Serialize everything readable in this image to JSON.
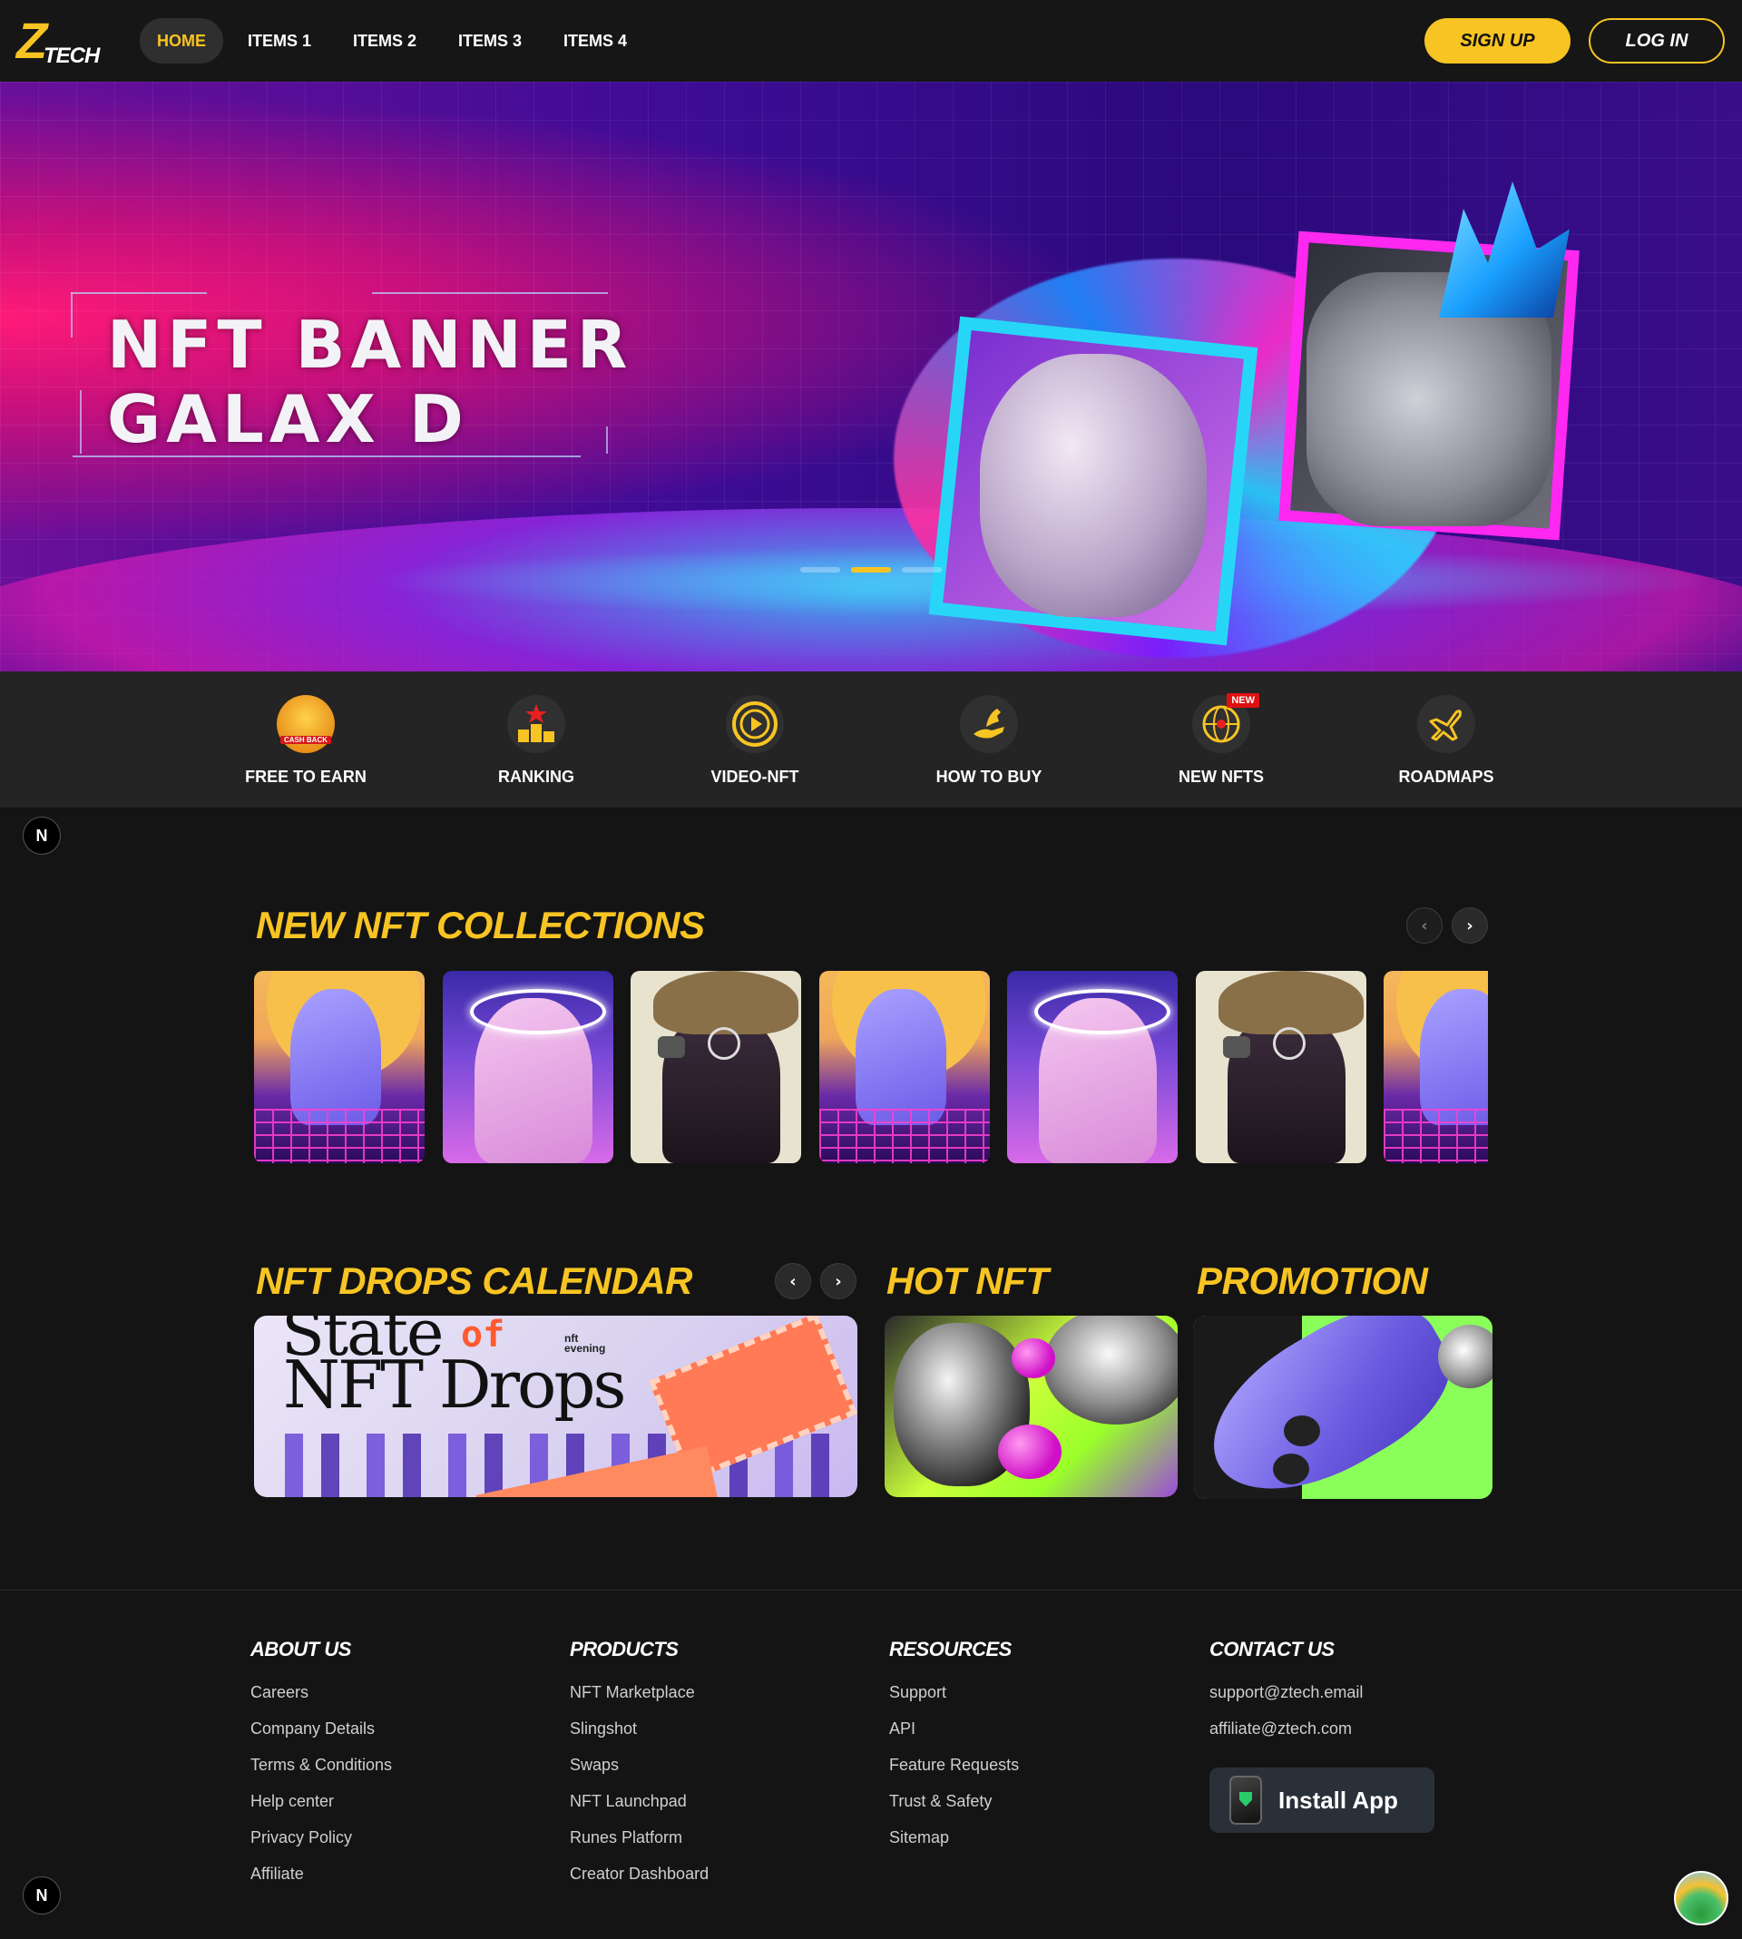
{
  "header": {
    "logo_mark": "Z",
    "logo_text": "TECH",
    "nav": [
      {
        "label": "HOME",
        "active": true
      },
      {
        "label": "ITEMS 1"
      },
      {
        "label": "ITEMS 2"
      },
      {
        "label": "ITEMS 3"
      },
      {
        "label": "ITEMS 4"
      }
    ],
    "signup_label": "SIGN UP",
    "login_label": "LOG IN"
  },
  "banner": {
    "title_line1": "NFT BANNER",
    "title_line2": "GALAX D",
    "slides_total": 3,
    "active_slide": 2
  },
  "categories": [
    {
      "label": "FREE TO EARN",
      "icon": "cashback-coin-icon",
      "icon_text": "CASH BACK"
    },
    {
      "label": "RANKING",
      "icon": "podium-star-icon"
    },
    {
      "label": "VIDEO-NFT",
      "icon": "play-circle-icon"
    },
    {
      "label": "HOW TO BUY",
      "icon": "horse-hand-icon"
    },
    {
      "label": "NEW NFTS",
      "icon": "globe-target-icon",
      "badge": "NEW"
    },
    {
      "label": "ROADMAPS",
      "icon": "airplane-icon"
    }
  ],
  "floating": {
    "n_label": "N"
  },
  "collections": {
    "title": "NEW NFT COLLECTIONS",
    "prev_icon": "chevron-left-icon",
    "next_icon": "chevron-right-icon",
    "items": [
      "bust-sunset",
      "bust-halo",
      "hat-mask",
      "bust-sunset",
      "bust-halo",
      "hat-mask",
      "bust-sunset"
    ]
  },
  "drops": {
    "title": "NFT DROPS CALENDAR",
    "image_text_line1": "State",
    "image_text_of": "of",
    "image_text_line2": "NFT Drops",
    "image_brand_top": "nft",
    "image_brand_bottom": "evening"
  },
  "hot": {
    "title": "HOT NFT"
  },
  "promotion": {
    "title": "PROMOTION"
  },
  "footer": {
    "columns": [
      {
        "heading": "ABOUT US",
        "links": [
          "Careers",
          "Company Details",
          "Terms & Conditions",
          "Help center",
          "Privacy Policy",
          "Affiliate"
        ]
      },
      {
        "heading": "PRODUCTS",
        "links": [
          "NFT Marketplace",
          "Slingshot",
          "Swaps",
          "NFT Launchpad",
          "Runes Platform",
          "Creator Dashboard"
        ]
      },
      {
        "heading": "RESOURCES",
        "links": [
          "Support",
          "API",
          "Feature Requests",
          "Trust & Safety",
          "Sitemap"
        ]
      },
      {
        "heading": "CONTACT US",
        "links": [
          "support@ztech.email",
          "affiliate@ztech.com"
        ]
      }
    ],
    "install_label": "Install App"
  },
  "colors": {
    "accent": "#f7c423",
    "background": "#141414",
    "category_bar": "#242424"
  }
}
